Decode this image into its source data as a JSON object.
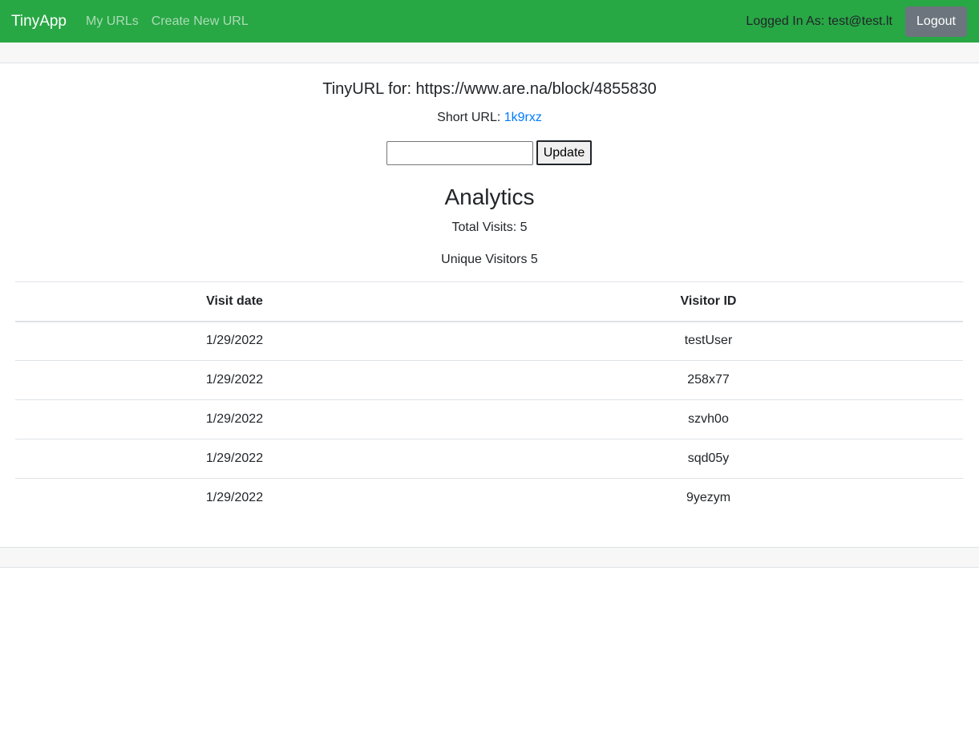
{
  "navbar": {
    "brand": "TinyApp",
    "links": [
      "My URLs",
      "Create New URL"
    ],
    "logged_in_text": "Logged In As: test@test.lt",
    "logout_label": "Logout",
    "color": "#28a745"
  },
  "url": {
    "title": "TinyURL for: https://www.are.na/block/4855830",
    "short_url_label": "Short URL: ",
    "short_url_value": "1k9rxz",
    "input_value": "",
    "update_label": "Update"
  },
  "analytics": {
    "heading": "Analytics",
    "total_visits": "Total Visits: 5",
    "unique_visitors": "Unique Visitors 5",
    "columns": [
      "Visit date",
      "Visitor ID"
    ],
    "rows": [
      [
        "1/29/2022",
        "testUser"
      ],
      [
        "1/29/2022",
        "258x77"
      ],
      [
        "1/29/2022",
        "szvh0o"
      ],
      [
        "1/29/2022",
        "sqd05y"
      ],
      [
        "1/29/2022",
        "9yezym"
      ]
    ]
  }
}
